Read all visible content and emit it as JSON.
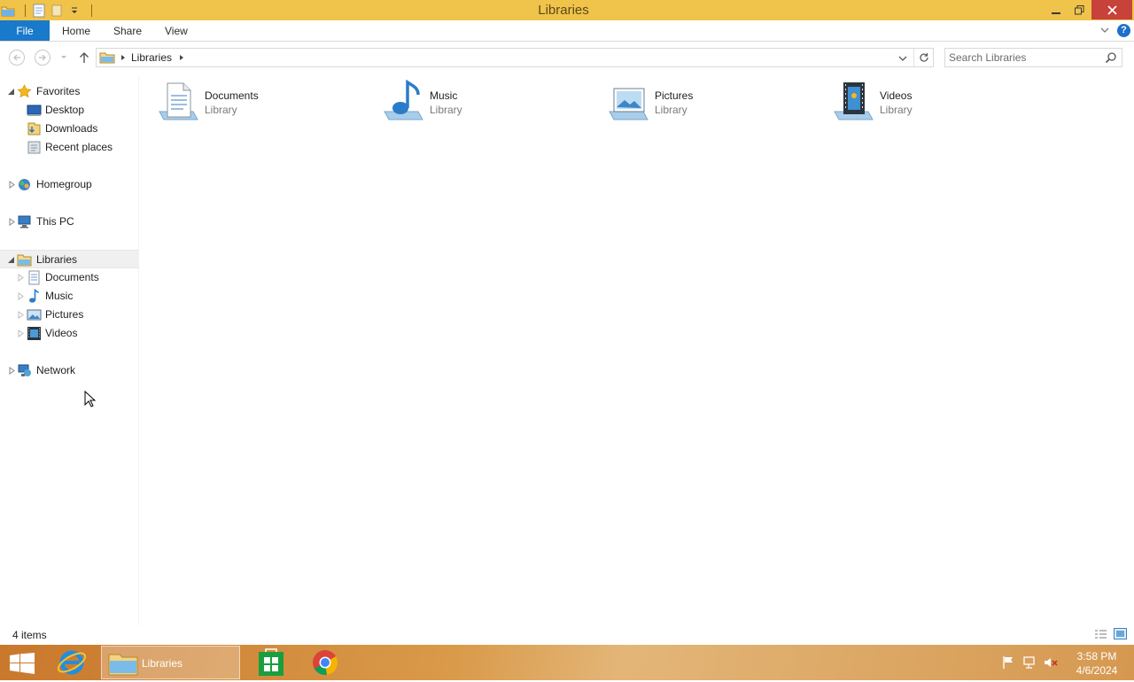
{
  "window": {
    "title": "Libraries"
  },
  "ribbon": {
    "tabs": {
      "file": "File",
      "home": "Home",
      "share": "Share",
      "view": "View"
    },
    "help": "?"
  },
  "address": {
    "crumb": "Libraries"
  },
  "search": {
    "placeholder": "Search Libraries"
  },
  "nav": {
    "favorites": "Favorites",
    "desktop": "Desktop",
    "downloads": "Downloads",
    "recent_places": "Recent places",
    "homegroup": "Homegroup",
    "this_pc": "This PC",
    "libraries": "Libraries",
    "documents": "Documents",
    "music": "Music",
    "pictures": "Pictures",
    "videos": "Videos",
    "network": "Network"
  },
  "content": {
    "items": [
      {
        "name": "Documents",
        "type": "Library",
        "icon": "documents-library-icon"
      },
      {
        "name": "Music",
        "type": "Library",
        "icon": "music-library-icon"
      },
      {
        "name": "Pictures",
        "type": "Library",
        "icon": "pictures-library-icon"
      },
      {
        "name": "Videos",
        "type": "Library",
        "icon": "videos-library-icon"
      }
    ]
  },
  "status": {
    "count": "4 items"
  },
  "taskbar": {
    "explorer_label": "Libraries",
    "time": "3:58 PM",
    "date": "4/6/2024"
  },
  "colors": {
    "title_bar": "#f0c34a",
    "file_tab": "#1979ca",
    "close_button": "#c7423a",
    "accent": "#1979ca"
  }
}
